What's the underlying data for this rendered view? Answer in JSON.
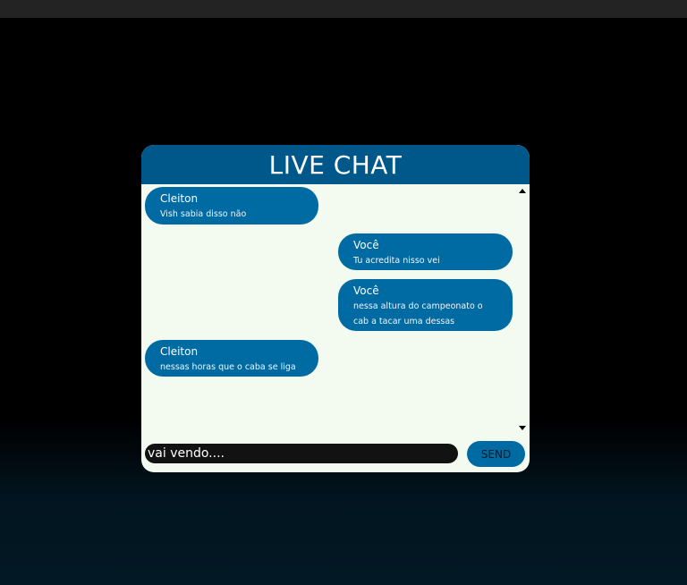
{
  "chat": {
    "title": "LIVE CHAT",
    "messages": [
      {
        "sender": "Cleiton",
        "text": "Vish sabia disso não",
        "side": "left"
      },
      {
        "sender": "Você",
        "text": "Tu acredita nisso vei",
        "side": "right"
      },
      {
        "sender": "Você",
        "text": "nessa altura do campeonato o cab a tacar uma dessas",
        "side": "right"
      },
      {
        "sender": "Cleiton",
        "text": "nessas horas que o caba se liga né",
        "side": "left"
      }
    ],
    "input": {
      "value": "vai vendo...."
    },
    "send_label": "SEND"
  },
  "colors": {
    "header": "#00588a",
    "bubble": "#006ba3",
    "chat_background": "#f3fbf0",
    "input_background": "#121212"
  }
}
